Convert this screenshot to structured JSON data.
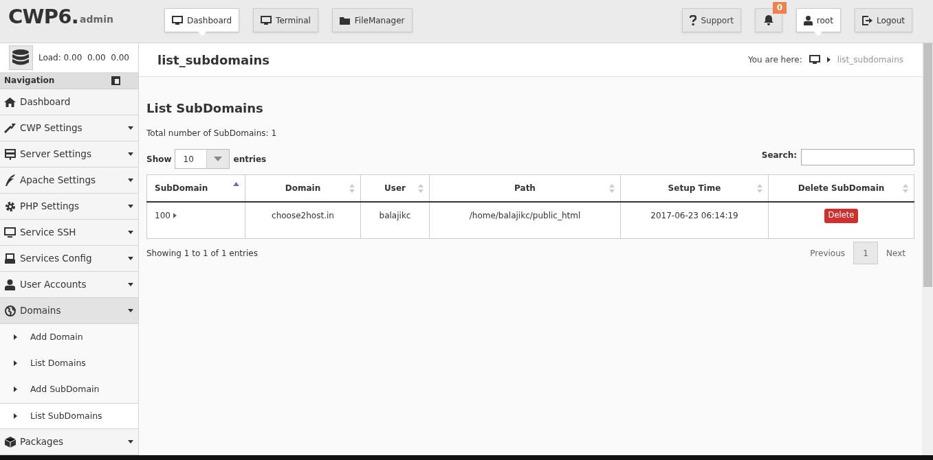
{
  "logo": {
    "main": "CWP6.",
    "sub": "admin"
  },
  "top_nav": [
    {
      "label": "Dashboard",
      "selected": true
    },
    {
      "label": "Terminal",
      "selected": false
    },
    {
      "label": "FileManager",
      "selected": false
    }
  ],
  "top_right": {
    "support": "Support",
    "notifications": "0",
    "user": {
      "label": "root",
      "selected": true
    },
    "logout": "Logout"
  },
  "load": "Load: 0.00  0.00  0.00",
  "page_title": "list_subdomains",
  "breadcrumb": {
    "label": "You are here:",
    "current": "list_subdomains"
  },
  "sidebar": {
    "title": "Navigation",
    "items": [
      {
        "label": "Dashboard",
        "dropdown": false,
        "expanded": false
      },
      {
        "label": "CWP Settings",
        "dropdown": true,
        "expanded": false
      },
      {
        "label": "Server Settings",
        "dropdown": true,
        "expanded": false
      },
      {
        "label": "Apache Settings",
        "dropdown": true,
        "expanded": false
      },
      {
        "label": "PHP Settings",
        "dropdown": true,
        "expanded": false
      },
      {
        "label": "Service SSH",
        "dropdown": true,
        "expanded": false
      },
      {
        "label": "Services Config",
        "dropdown": true,
        "expanded": false
      },
      {
        "label": "User Accounts",
        "dropdown": true,
        "expanded": false
      },
      {
        "label": "Domains",
        "dropdown": true,
        "expanded": true,
        "children": [
          {
            "label": "Add Domain",
            "selected": false
          },
          {
            "label": "List Domains",
            "selected": false
          },
          {
            "label": "Add SubDomain",
            "selected": false
          },
          {
            "label": "List SubDomains",
            "selected": true
          }
        ]
      },
      {
        "label": "Packages",
        "dropdown": true,
        "expanded": false
      }
    ]
  },
  "content": {
    "heading": "List SubDomains",
    "total": "Total number of SubDomains: 1",
    "show_label": "Show",
    "page_size": "10",
    "entries_label": "entries",
    "search_label": "Search:",
    "table": {
      "columns": [
        {
          "label": "SubDomain",
          "sorted": true
        },
        {
          "label": "Domain",
          "sorted": false
        },
        {
          "label": "User",
          "sorted": false
        },
        {
          "label": "Path",
          "sorted": false
        },
        {
          "label": "Setup Time",
          "sorted": false
        },
        {
          "label": "Delete SubDomain",
          "sorted": false
        }
      ],
      "rows": [
        {
          "subdomain": "100",
          "domain": "choose2host.in",
          "user": "balajikc",
          "path": "/home/balajikc/public_html",
          "setup_time": "2017-06-23 06:14:19",
          "action": "Delete"
        }
      ]
    },
    "info": "Showing 1 to 1 of 1 entries",
    "pagination": {
      "previous": "Previous",
      "pages": [
        {
          "label": "1",
          "selected": true
        }
      ],
      "next": "Next"
    }
  }
}
